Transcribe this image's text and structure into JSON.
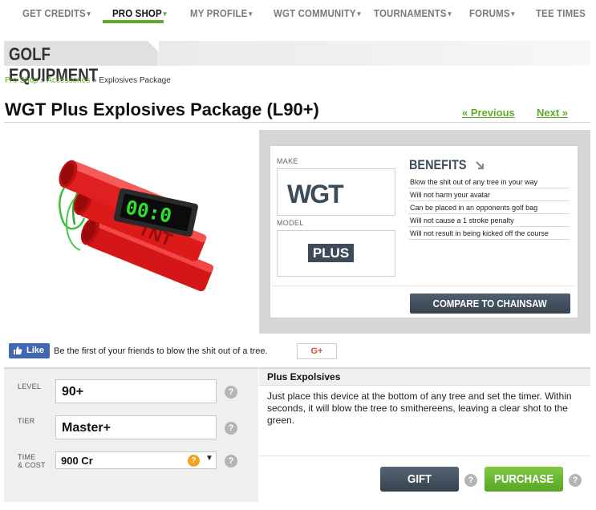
{
  "nav": {
    "items": [
      {
        "label": "GET CREDITS",
        "caret": "▾"
      },
      {
        "label": "PRO SHOP",
        "caret": "▾"
      },
      {
        "label": "MY PROFILE",
        "caret": "▾"
      },
      {
        "label": "WGT COMMUNITY",
        "caret": "▾"
      },
      {
        "label": "TOURNAMENTS",
        "caret": "▾"
      },
      {
        "label": "FORUMS",
        "caret": "▾"
      },
      {
        "label": "TEE TIMES",
        "caret": ""
      }
    ],
    "active_index": 1,
    "accent_color": "#5eab2b"
  },
  "section": {
    "title": "GOLF EQUIPMENT"
  },
  "breadcrumb": {
    "items": [
      "Pro Shop",
      "Accessories",
      "Explosives Package"
    ],
    "separator": "»"
  },
  "product": {
    "title": "WGT Plus Explosives Package (L90+)",
    "prev_label": "« Previous",
    "next_label": "Next »",
    "image_icon": "tnt-bomb-timer-image",
    "timer_text": "00:0"
  },
  "details": {
    "make_label": "MAKE",
    "make_value": "WGT",
    "model_label": "MODEL",
    "model_value": "PLUS",
    "benefits_title": "BENEFITS",
    "benefits": [
      "Blow the shit out of any tree in your way",
      "Will not harm your avatar",
      "Can be placed in an opponents golf bag",
      "Will not cause a 1 stroke penalty",
      "Will not result in being kicked off the course"
    ],
    "compare_label": "COMPARE TO CHAINSAW"
  },
  "social": {
    "like_label": "Like",
    "text": "Be the first of your friends to blow the shit out of a tree.",
    "gplus_label": "G+"
  },
  "purchase": {
    "level_label": "LEVEL",
    "level_value": "90+",
    "tier_label": "TIER",
    "tier_value": "Master+",
    "time_label_line1": "TIME",
    "time_label_line2": "& COST",
    "cost_value": "900 Cr",
    "help_glyph": "?",
    "gift_label": "GIFT",
    "purchase_label": "PURCHASE"
  },
  "description": {
    "title": "Plus Expolsives",
    "text": "Just place this device at the bottom of any tree and set the timer. Within seconds, it will blow the tree to smithereens, leaving a clear shot to the green."
  }
}
